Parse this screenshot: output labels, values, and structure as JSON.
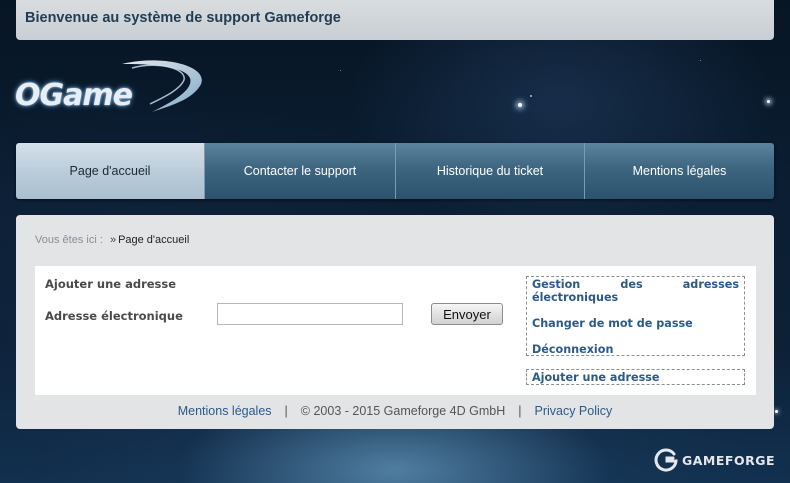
{
  "header": {
    "title": "Bienvenue au système de support Gameforge"
  },
  "logo": {
    "text": "OGame",
    "icon": "ogame-logo-icon"
  },
  "nav": {
    "tabs": [
      {
        "label": "Page d'accueil",
        "active": true
      },
      {
        "label": "Contacter le support",
        "active": false
      },
      {
        "label": "Historique du ticket",
        "active": false
      },
      {
        "label": "Mentions légales",
        "active": false
      }
    ]
  },
  "breadcrumb": {
    "prefix": "Vous êtes ici :",
    "separator": "»",
    "current": "Page d'accueil"
  },
  "form": {
    "section_title": "Ajouter une adresse",
    "email_label": "Adresse électronique",
    "email_value": "",
    "email_placeholder": "",
    "submit_label": "Envoyer"
  },
  "sidebar": {
    "links": [
      "Gestion des adresses électroniques",
      "Changer de mot de passe",
      "Déconnexion"
    ],
    "secondary_link": "Ajouter une adresse"
  },
  "footer": {
    "legal_link": "Mentions légales",
    "copyright": "© 2003 - 2015 Gameforge 4D GmbH",
    "privacy_link": "Privacy Policy",
    "separator": "|"
  },
  "brand": {
    "name": "GAMEFORGE",
    "icon": "gameforge-logo-icon",
    "accent_color": "#2c5a88",
    "nav_color": "#3d6580"
  }
}
